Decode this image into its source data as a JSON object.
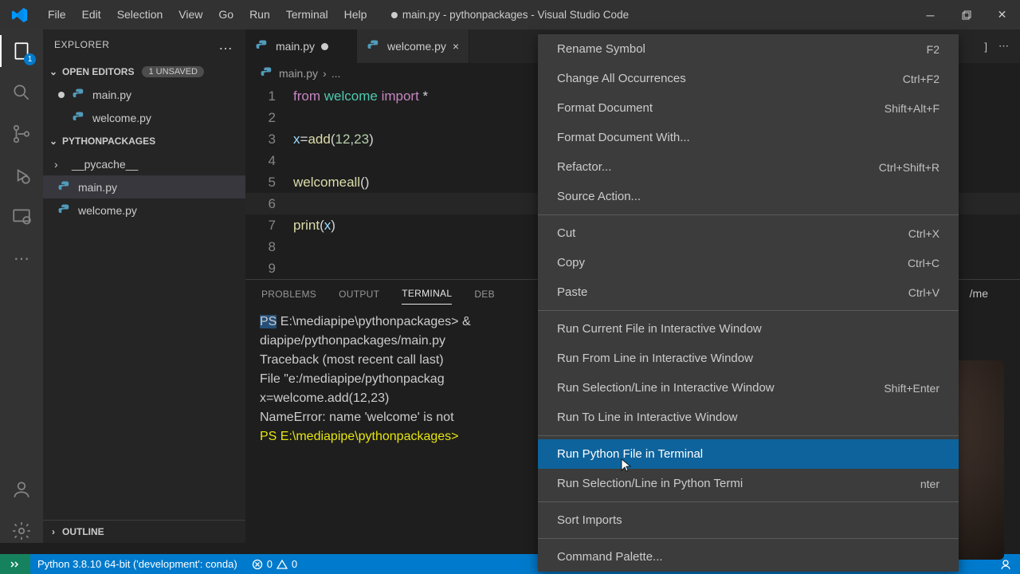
{
  "title": "main.py - pythonpackages - Visual Studio Code",
  "menu": [
    "File",
    "Edit",
    "Selection",
    "View",
    "Go",
    "Run",
    "Terminal",
    "Help"
  ],
  "explorer": {
    "label": "EXPLORER",
    "openEditors": "OPEN EDITORS",
    "unsaved": "1 UNSAVED",
    "oe": [
      {
        "name": "main.py",
        "dirty": true
      },
      {
        "name": "welcome.py",
        "dirty": false
      }
    ],
    "folder": "PYTHONPACKAGES",
    "tree": [
      {
        "name": "__pycache__",
        "type": "folder"
      },
      {
        "name": "main.py",
        "type": "py",
        "active": true
      },
      {
        "name": "welcome.py",
        "type": "py"
      }
    ],
    "outline": "OUTLINE"
  },
  "tabs": [
    {
      "name": "main.py",
      "active": true,
      "dirty": true
    },
    {
      "name": "welcome.py",
      "active": false,
      "dirty": false
    }
  ],
  "breadcrumb": {
    "file": "main.py",
    "sep": "›",
    "rest": "..."
  },
  "code": [
    {
      "n": 1,
      "html": "<span class='kw'>from</span> <span class='s1'>welcome</span> <span class='kw'>import</span> <span class='star'>*</span>"
    },
    {
      "n": 2,
      "html": ""
    },
    {
      "n": 3,
      "html": "<span class='var'>x</span><span class='op'>=</span><span class='fn'>add</span><span class='op'>(</span><span class='num'>12</span><span class='op'>,</span><span class='num'>23</span><span class='op'>)</span>"
    },
    {
      "n": 4,
      "html": ""
    },
    {
      "n": 5,
      "html": "<span class='fn'>welcomeall</span><span class='op'>()</span>"
    },
    {
      "n": 6,
      "html": "",
      "cur": true
    },
    {
      "n": 7,
      "html": "<span class='fn'>print</span><span class='op'>(</span><span class='var'>x</span><span class='op'>)</span>"
    },
    {
      "n": 8,
      "html": ""
    },
    {
      "n": 9,
      "html": ""
    }
  ],
  "panel": {
    "tabs": [
      "PROBLEMS",
      "OUTPUT",
      "TERMINAL",
      "DEB"
    ],
    "active": "TERMINAL",
    "right": "/me",
    "lines": [
      "<span class='hl'>PS</span> E:\\mediapipe\\pythonpackages> &",
      "diapipe/pythonpackages/main.py",
      "Traceback (most recent call last)",
      "  File \"e:/mediapipe/pythonpackag",
      "    x=welcome.add(12,23)",
      "NameError: name 'welcome' is not",
      "<span class='yel'>PS E:\\mediapipe\\pythonpackages></span>"
    ]
  },
  "context": [
    {
      "l": "Rename Symbol",
      "k": "F2"
    },
    {
      "l": "Change All Occurrences",
      "k": "Ctrl+F2"
    },
    {
      "l": "Format Document",
      "k": "Shift+Alt+F"
    },
    {
      "l": "Format Document With..."
    },
    {
      "l": "Refactor...",
      "k": "Ctrl+Shift+R"
    },
    {
      "l": "Source Action..."
    },
    {
      "sep": true
    },
    {
      "l": "Cut",
      "k": "Ctrl+X"
    },
    {
      "l": "Copy",
      "k": "Ctrl+C"
    },
    {
      "l": "Paste",
      "k": "Ctrl+V"
    },
    {
      "sep": true
    },
    {
      "l": "Run Current File in Interactive Window"
    },
    {
      "l": "Run From Line in Interactive Window"
    },
    {
      "l": "Run Selection/Line in Interactive Window",
      "k": "Shift+Enter"
    },
    {
      "l": "Run To Line in Interactive Window"
    },
    {
      "sep": true
    },
    {
      "l": "Run Python File in Terminal",
      "hl": true
    },
    {
      "l": "Run Selection/Line in Python Termi",
      "k": "nter"
    },
    {
      "sep": true
    },
    {
      "l": "Sort Imports"
    },
    {
      "sep": true
    },
    {
      "l": "Command Palette..."
    }
  ],
  "status": {
    "python": "Python 3.8.10 64-bit ('development': conda)",
    "err": "0",
    "warn": "0"
  }
}
